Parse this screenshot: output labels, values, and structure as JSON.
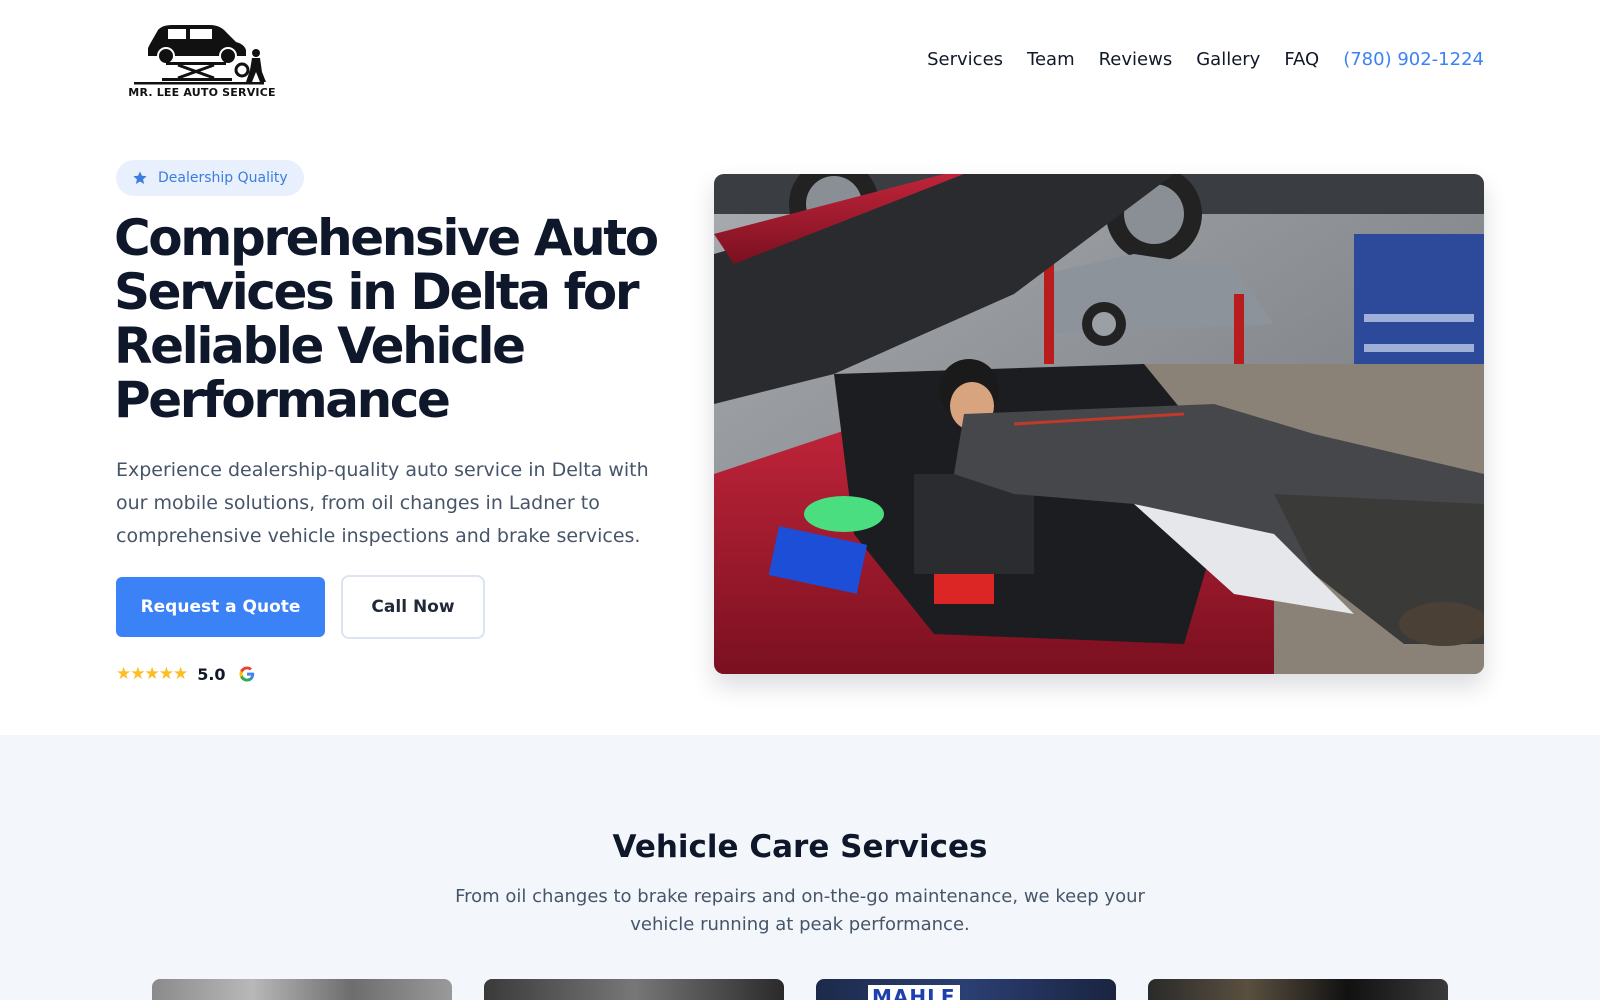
{
  "brand": {
    "logo_text": "MR. LEE AUTO SERVICE",
    "accent_color": "#3b82f6"
  },
  "nav": {
    "items": [
      {
        "label": "Services"
      },
      {
        "label": "Team"
      },
      {
        "label": "Reviews"
      },
      {
        "label": "Gallery"
      },
      {
        "label": "FAQ"
      }
    ],
    "phone": "(780) 902-1224"
  },
  "hero": {
    "badge": "Dealership Quality",
    "badge_icon": "star-icon",
    "title": "Comprehensive Auto Services in Delta for Reliable Vehicle Performance",
    "description": "Experience dealership-quality auto service in Delta with our mobile solutions, from oil changes in Ladner to comprehensive vehicle inspections and brake services.",
    "primary_button": "Request a Quote",
    "secondary_button": "Call Now",
    "rating_stars": "★★★★★",
    "rating_value": "5.0",
    "rating_source_icon": "google-icon"
  },
  "services": {
    "title": "Vehicle Care Services",
    "description": "From oil changes to brake repairs and on-the-go maintenance, we keep your vehicle running at peak performance.",
    "card_brand_text": "MAHLE"
  }
}
